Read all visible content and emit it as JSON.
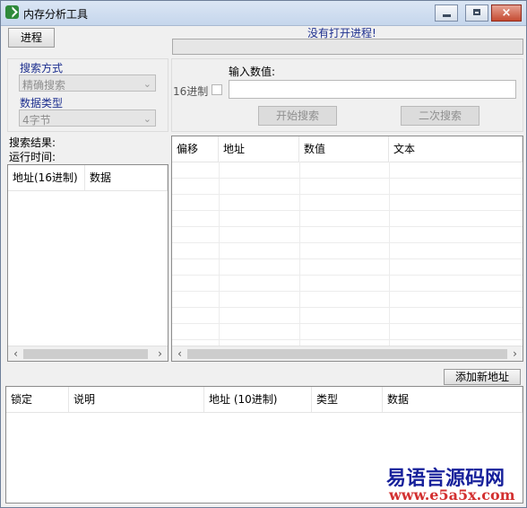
{
  "window": {
    "title": "内存分析工具",
    "close_glyph": "×"
  },
  "process": {
    "button_label": "进程",
    "status": "没有打开进程!"
  },
  "search": {
    "mode_label": "搜索方式",
    "mode_value": "精确搜索",
    "type_label": "数据类型",
    "type_value": "4字节",
    "input_label": "输入数值:",
    "hex_label": "16进制",
    "hex_checked": false,
    "input_value": "",
    "start_button": "开始搜索",
    "second_button": "二次搜索"
  },
  "results": {
    "result_label": "搜索结果:",
    "time_label": "运行时间:",
    "columns": [
      "地址(16进制)",
      "数据"
    ]
  },
  "memory_table": {
    "columns": [
      "偏移",
      "地址",
      "数值",
      "文本"
    ]
  },
  "address_list": {
    "add_button": "添加新地址",
    "columns": [
      "锁定",
      "说明",
      "地址 (10进制)",
      "类型",
      "数据"
    ]
  },
  "watermark": {
    "brand": "易语言源码网",
    "url": "www.e5a5x.com"
  },
  "icons": {
    "scroll_left": "‹",
    "scroll_right": "›",
    "dropdown": "⌄"
  }
}
